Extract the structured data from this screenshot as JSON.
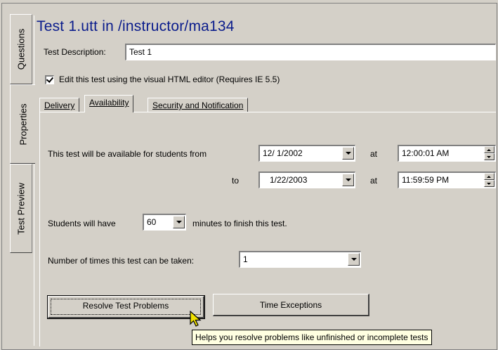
{
  "side_tabs": [
    {
      "label": "Questions"
    },
    {
      "label": "Properties"
    },
    {
      "label": "Test Preview"
    }
  ],
  "header": {
    "title": "Test 1.utt in /instructor/ma134"
  },
  "description": {
    "label": "Test Description:",
    "value": "Test 1"
  },
  "editor_option": {
    "label": "Edit this test using the visual HTML editor (Requires IE 5.5)",
    "checked": true
  },
  "tabs": [
    {
      "label": "Delivery"
    },
    {
      "label": "Availability"
    },
    {
      "label": "Security and Notification"
    }
  ],
  "availability": {
    "from_label": "This test will be available for students from",
    "from_date": "12/ 1/2002",
    "at_label": "at",
    "from_time": "12:00:01 AM",
    "to_label": "to",
    "to_date": "1/22/2003",
    "to_time": "11:59:59 PM",
    "students_label": "Students will have",
    "minutes_value": "60",
    "minutes_label": "minutes to finish this test.",
    "times_label": "Number of times this test can be taken:",
    "times_value": "1"
  },
  "buttons": {
    "resolve": "Resolve Test Problems",
    "exceptions": "Time Exceptions"
  },
  "tooltip": "Helps you resolve problems like unfinished or incomplete tests"
}
